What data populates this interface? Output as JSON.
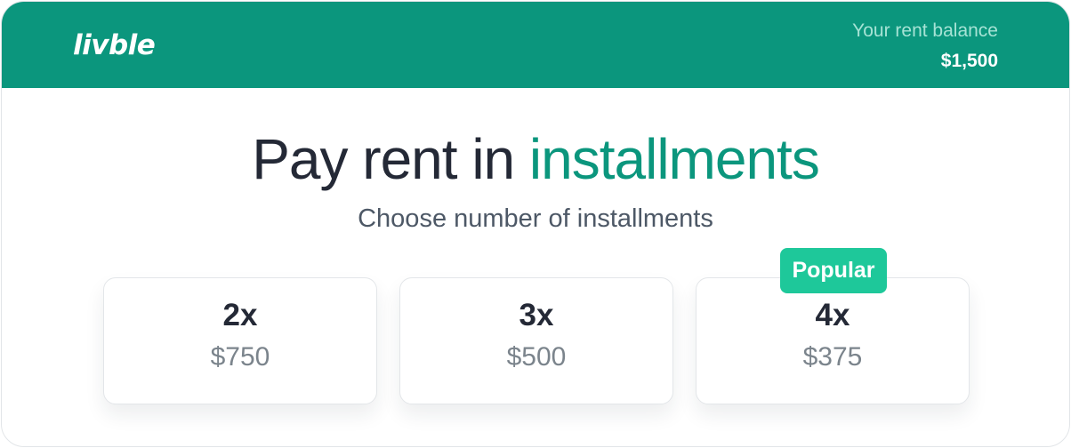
{
  "brand": {
    "logo_text": "livble",
    "accent_color": "#0b967d",
    "badge_color": "#1ec89a"
  },
  "balance": {
    "label": "Your rent balance",
    "value": "$1,500"
  },
  "hero": {
    "title_prefix": "Pay rent in ",
    "title_accent": "installments",
    "subtitle": "Choose number of installments"
  },
  "options": [
    {
      "count": "2x",
      "amount": "$750"
    },
    {
      "count": "3x",
      "amount": "$500"
    },
    {
      "count": "4x",
      "amount": "$375",
      "badge": "Popular"
    }
  ]
}
